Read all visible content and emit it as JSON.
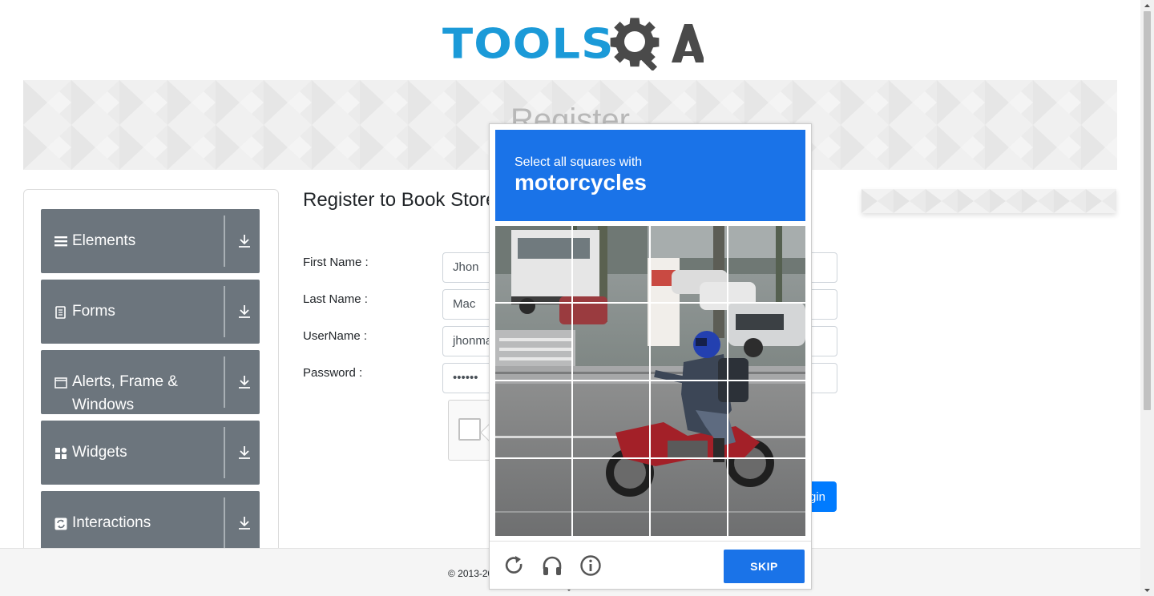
{
  "header": {
    "logo_text": "TOOLSQA"
  },
  "banner": {
    "title": "Register"
  },
  "sidebar": {
    "groups": [
      {
        "label": "Elements",
        "icon": "list-icon"
      },
      {
        "label": "Forms",
        "icon": "document-icon"
      },
      {
        "label": "Alerts, Frame & Windows",
        "icon": "window-icon"
      },
      {
        "label": "Widgets",
        "icon": "widgets-icon"
      },
      {
        "label": "Interactions",
        "icon": "interactions-icon"
      }
    ]
  },
  "form": {
    "title": "Register to Book Store",
    "fields": [
      {
        "label": "First Name :",
        "value": "Jhon"
      },
      {
        "label": "Last Name :",
        "value": "Mac"
      },
      {
        "label": "UserName :",
        "value": "jhonmac"
      },
      {
        "label": "Password :",
        "value": "••••••"
      }
    ],
    "login_label": "Login"
  },
  "footer": {
    "text": "© 2013-2020 TOOLSQA.COM | ALL RIGHTS RESERVED."
  },
  "captcha": {
    "prompt": "Select all squares with",
    "target": "motorcycles",
    "skip_label": "SKIP",
    "grid_size": 4,
    "colors": {
      "header": "#1a73e8",
      "skip": "#1a73e8"
    }
  },
  "colors": {
    "brand_blue": "#1b9ad8",
    "sidebar_group": "#6c757d",
    "primary": "#007bff"
  }
}
